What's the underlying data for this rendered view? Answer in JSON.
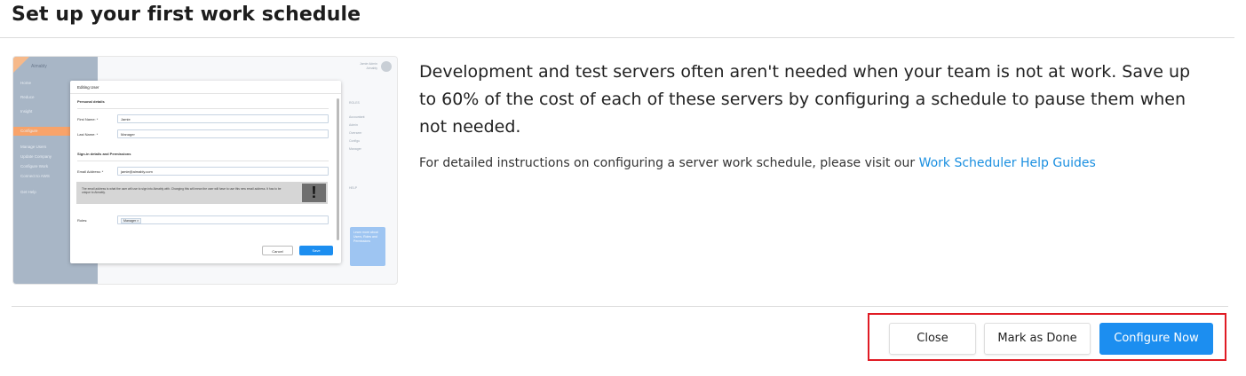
{
  "page": {
    "title": "Set up your first work schedule",
    "description": "Development and test servers often aren't needed when your team is not at work. Save up to 60% of the cost of each of these servers by configuring a schedule to pause them when not needed.",
    "help_prefix": "For detailed instructions on configuring a server work schedule, please visit our ",
    "help_link": "Work Scheduler Help Guides"
  },
  "thumbnail": {
    "brand": "Aimably",
    "user_line1": "Jamie Admin",
    "user_line2": "Aimably",
    "side_nav": [
      "Home",
      "Reduce",
      "Insight",
      "Configure",
      "Manage Users",
      "Update Company",
      "Configure Work",
      "Connect to AWS",
      "Get Help"
    ],
    "right_col_lines": [
      "ROLES",
      "Accountant",
      "Admin",
      "Overseer",
      "Configu",
      "Manager",
      "HELP"
    ],
    "help_box_text": "Learn more about Users, Roles and Permissions",
    "dialog": {
      "title": "Editing User",
      "section_personal": "Personal details",
      "first_name_label": "First Name: *",
      "first_name_value": "Jamie",
      "last_name_label": "Last Name: *",
      "last_name_value": "Manager",
      "section_signin": "Sign-in details and Permissions",
      "email_label": "Email Address: *",
      "email_value": "jamie@aimably.com",
      "warning_text": "The email address is what the user will use to sign into Aimably with. Changing this will mean the user will have to use this new email address. It has to be unique to Aimably.",
      "warning_icon": "!",
      "roles_label": "Roles:",
      "roles_value": "Manager ×",
      "cancel_label": "Cancel",
      "save_label": "Save"
    }
  },
  "footer": {
    "close_label": "Close",
    "mark_done_label": "Mark as Done",
    "configure_label": "Configure Now"
  },
  "colors": {
    "primary": "#1c8ef0",
    "highlight": "#e01b24",
    "link": "#1a8fe0"
  }
}
